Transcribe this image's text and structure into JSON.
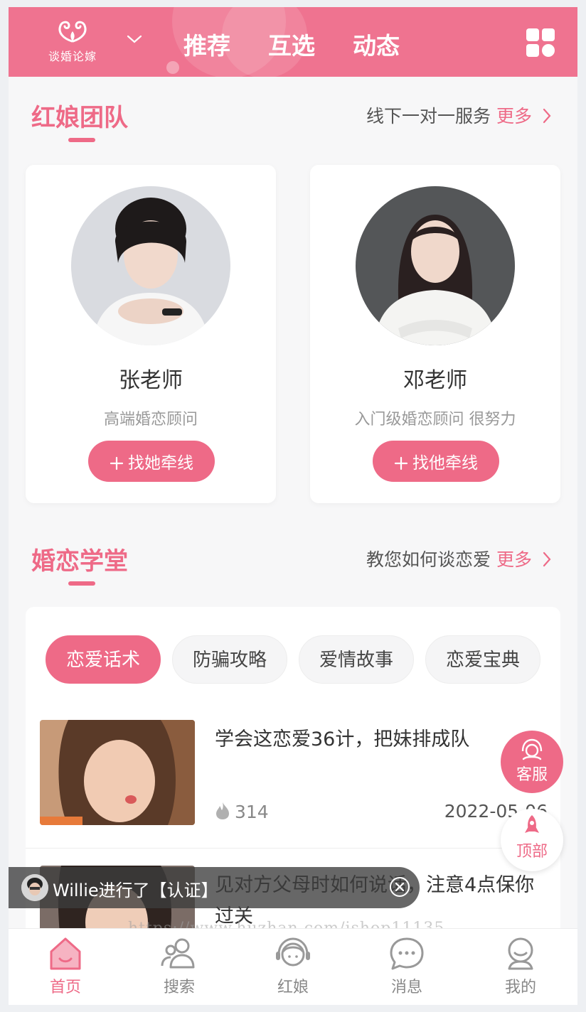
{
  "header": {
    "logo_text": "谈婚论嫁",
    "tabs": [
      "推荐",
      "互选",
      "动态"
    ]
  },
  "matchmaker_section": {
    "title": "红娘团队",
    "subtitle": "线下一对一服务",
    "more": "更多",
    "cards": [
      {
        "name": "张老师",
        "desc": "高端婚恋顾问",
        "button": "找她牵线"
      },
      {
        "name": "邓老师",
        "desc": "入门级婚恋顾问 很努力",
        "button": "找他牵线"
      }
    ]
  },
  "school_section": {
    "title": "婚恋学堂",
    "subtitle": "教您如何谈恋爱",
    "more": "更多",
    "chips": [
      "恋爱话术",
      "防骗攻略",
      "爱情故事",
      "恋爱宝典"
    ],
    "articles": [
      {
        "title": "学会这恋爱36计，把妹排成队",
        "views": "314",
        "date": "2022-05-06"
      },
      {
        "title": "见对方父母时如何说话，注意4点保你过关"
      }
    ]
  },
  "floating": {
    "service": "客服",
    "top": "顶部"
  },
  "toast": {
    "text": "Willie进行了【认证】"
  },
  "watermark": "https://www.huzhan.com/ishop11135",
  "tabbar": [
    "首页",
    "搜索",
    "红娘",
    "消息",
    "我的"
  ],
  "colors": {
    "accent": "#ee6a87",
    "header": "#ef7390"
  }
}
